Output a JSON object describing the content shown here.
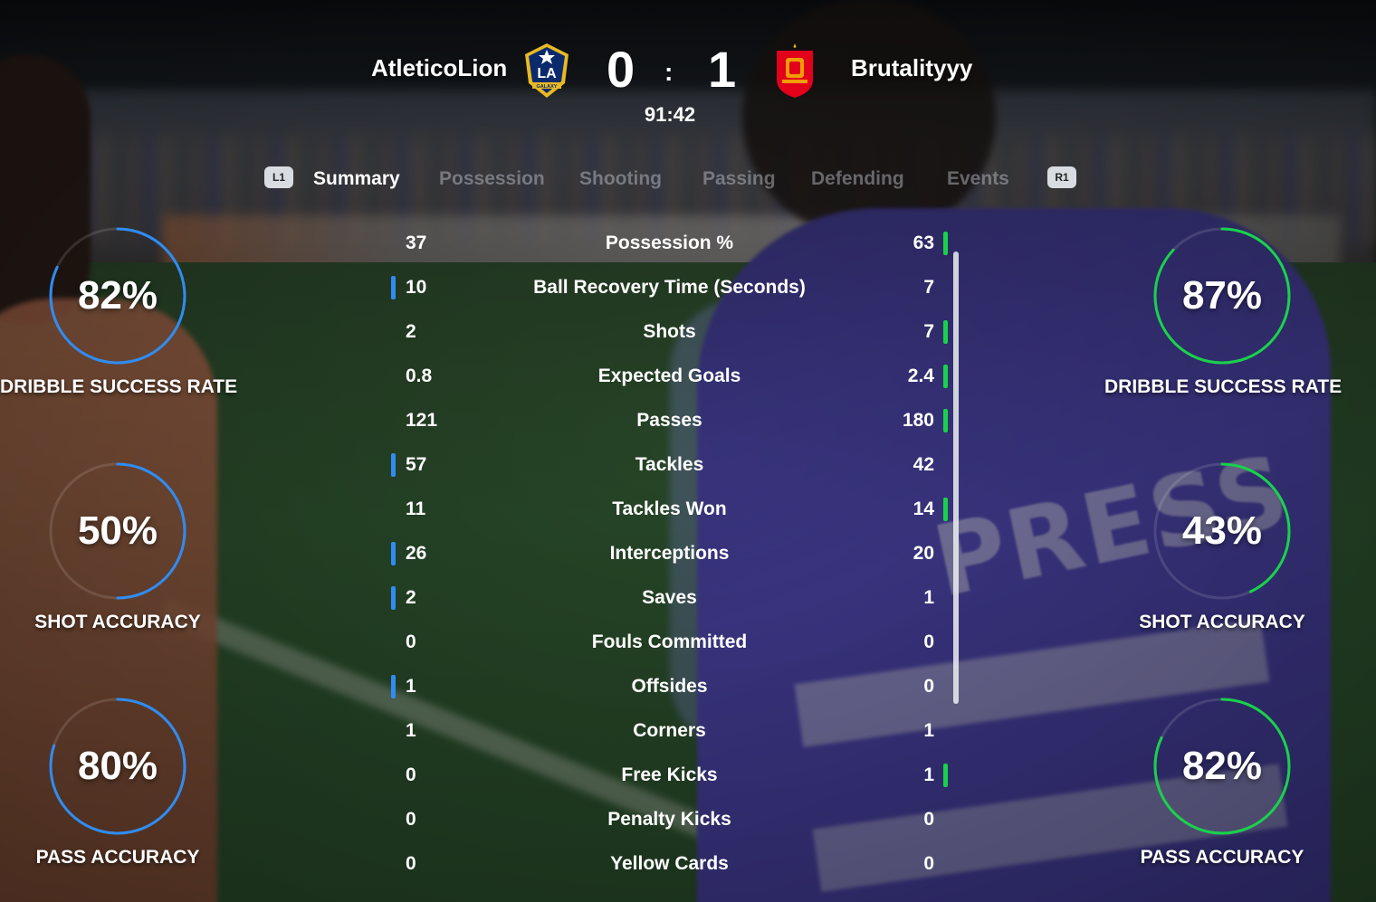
{
  "header": {
    "home_team": "AtleticoLion",
    "away_team": "Brutalityyy",
    "home_score": "0",
    "separator": ":",
    "away_score": "1",
    "clock": "91:42",
    "home_crest_text": "LA",
    "home_crest_subtext": "GALAXY"
  },
  "tabs": {
    "left_button": "L1",
    "right_button": "R1",
    "items": [
      "Summary",
      "Possession",
      "Shooting",
      "Passing",
      "Defending",
      "Events"
    ],
    "active": "Summary"
  },
  "colors": {
    "home_accent": "#2f8cf2",
    "away_accent": "#18d24b"
  },
  "stats": [
    {
      "label": "Possession %",
      "home": "37",
      "away": "63",
      "leader": "away"
    },
    {
      "label": "Ball Recovery Time (Seconds)",
      "home": "10",
      "away": "7",
      "leader": "home"
    },
    {
      "label": "Shots",
      "home": "2",
      "away": "7",
      "leader": "away"
    },
    {
      "label": "Expected Goals",
      "home": "0.8",
      "away": "2.4",
      "leader": "away"
    },
    {
      "label": "Passes",
      "home": "121",
      "away": "180",
      "leader": "away"
    },
    {
      "label": "Tackles",
      "home": "57",
      "away": "42",
      "leader": "home"
    },
    {
      "label": "Tackles Won",
      "home": "11",
      "away": "14",
      "leader": "away"
    },
    {
      "label": "Interceptions",
      "home": "26",
      "away": "20",
      "leader": "home"
    },
    {
      "label": "Saves",
      "home": "2",
      "away": "1",
      "leader": "home"
    },
    {
      "label": "Fouls Committed",
      "home": "0",
      "away": "0",
      "leader": "none"
    },
    {
      "label": "Offsides",
      "home": "1",
      "away": "0",
      "leader": "home"
    },
    {
      "label": "Corners",
      "home": "1",
      "away": "1",
      "leader": "none"
    },
    {
      "label": "Free Kicks",
      "home": "0",
      "away": "1",
      "leader": "away"
    },
    {
      "label": "Penalty Kicks",
      "home": "0",
      "away": "0",
      "leader": "none"
    },
    {
      "label": "Yellow Cards",
      "home": "0",
      "away": "0",
      "leader": "none"
    }
  ],
  "home_rings": [
    {
      "value": "82%",
      "fraction": 0.82,
      "caption": "DRIBBLE SUCCESS RATE"
    },
    {
      "value": "50%",
      "fraction": 0.5,
      "caption": "SHOT ACCURACY"
    },
    {
      "value": "80%",
      "fraction": 0.8,
      "caption": "PASS ACCURACY"
    }
  ],
  "away_rings": [
    {
      "value": "87%",
      "fraction": 0.87,
      "caption": "DRIBBLE SUCCESS RATE"
    },
    {
      "value": "43%",
      "fraction": 0.43,
      "caption": "SHOT ACCURACY"
    },
    {
      "value": "82%",
      "fraction": 0.82,
      "caption": "PASS ACCURACY"
    }
  ]
}
